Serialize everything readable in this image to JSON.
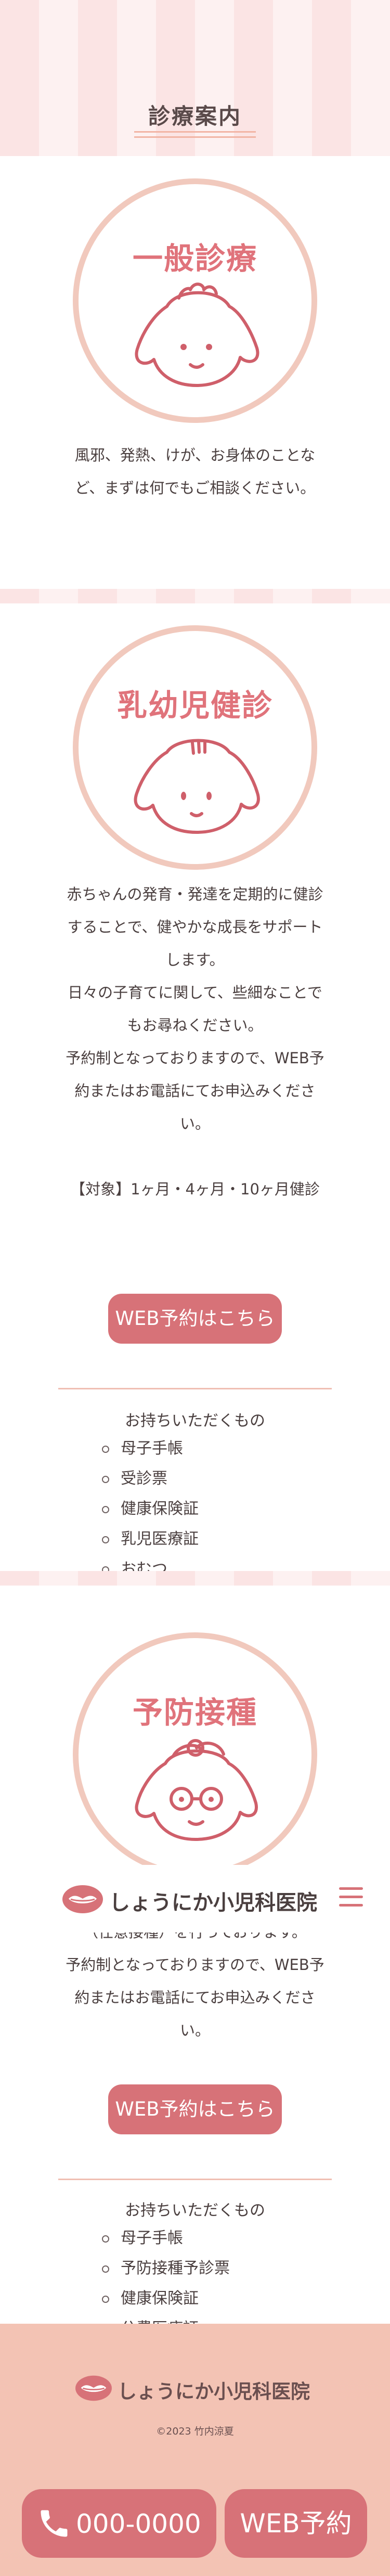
{
  "page": {
    "title": "診療案内"
  },
  "header": {
    "clinic_name": "しょうにか小児科医院",
    "logo_icon": "lips-logo-icon",
    "menu_icon": "hamburger-menu-icon"
  },
  "colors": {
    "accent": "#d77278",
    "title_pink": "#e0737b",
    "circle_border": "#f1c9bd",
    "footer_bg": "#f3c3b4",
    "stripe_a": "#fbe4e4",
    "stripe_b": "#fdf1f1"
  },
  "sections": {
    "general": {
      "title": "一般診療",
      "description": "風邪、発熱、けが、お身体のことなど、まずは何でもご相談ください。"
    },
    "checkup": {
      "title": "乳幼児健診",
      "paragraphs": [
        "赤ちゃんの発育・発達を定期的に健診することで、健やかな成長をサポートします。",
        "日々の子育てに関して、些細なことでもお尋ねください。",
        "予約制となっておりますので、WEB予約またはお電話にてお申込みください。"
      ],
      "target": "【対象】1ヶ月・4ヶ月・10ヶ月健診",
      "web_button": "WEB予約はこちら",
      "items_title": "お持ちいただくもの",
      "items": [
        "母子手帳",
        "受診票",
        "健康保険証",
        "乳児医療証",
        "おむつ"
      ]
    },
    "vaccination": {
      "title": "予防接種",
      "partial_line": "（任意接種）を行っております。",
      "paragraphs": [
        "予約制となっておりますので、WEB予約またはお電話にてお申込みください。"
      ],
      "web_button": "WEB予約はこちら",
      "items_title": "お持ちいただくもの",
      "items": [
        "母子手帳",
        "予防接種予診票",
        "健康保険証",
        "公費医療証"
      ]
    }
  },
  "footer": {
    "clinic_name": "しょうにか小児科医院",
    "copyright": "©2023 竹内涼夏",
    "phone_label": "000-0000",
    "phone_icon": "phone-icon",
    "web_label": "WEB予約"
  }
}
